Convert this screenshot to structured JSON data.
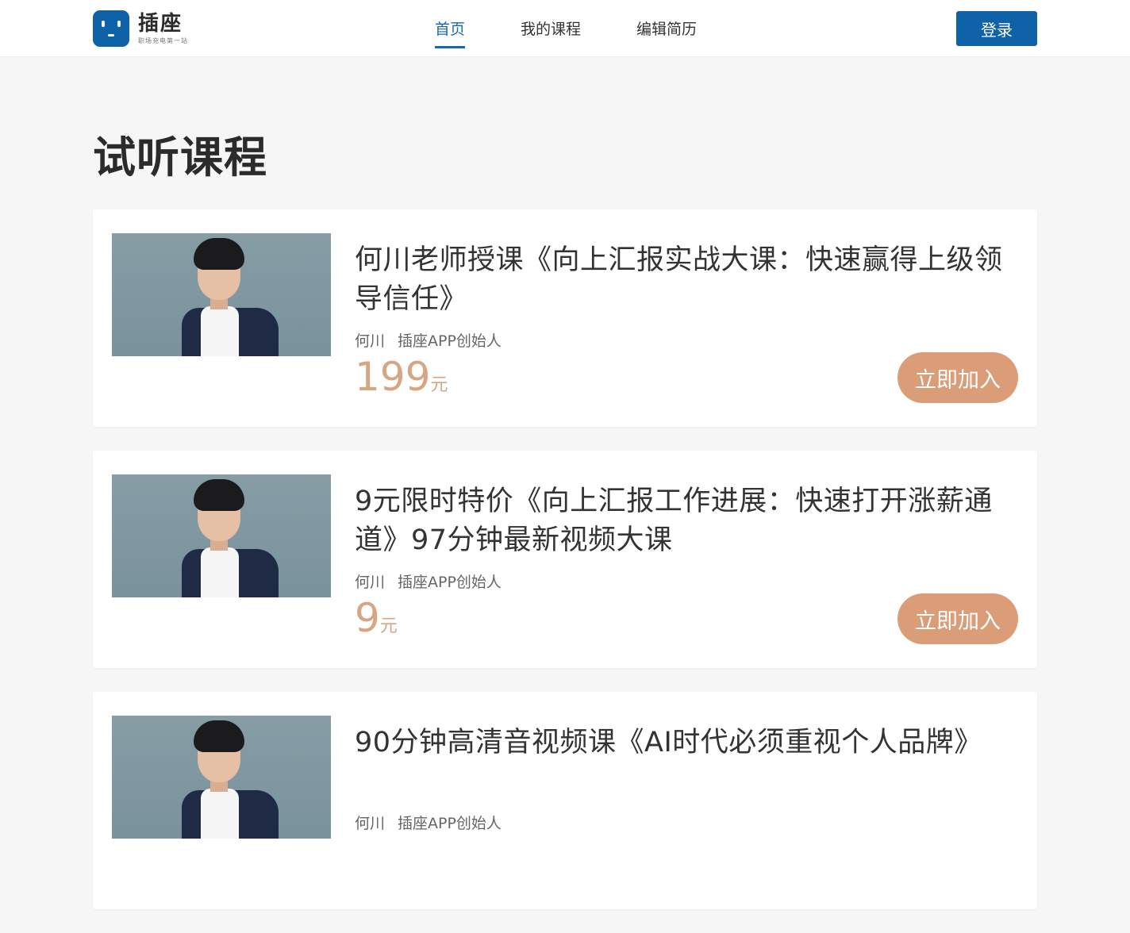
{
  "header": {
    "logo_name": "插座",
    "logo_slogan": "职场充电第一站",
    "nav": [
      {
        "label": "首页",
        "active": true
      },
      {
        "label": "我的课程",
        "active": false
      },
      {
        "label": "编辑简历",
        "active": false
      }
    ],
    "login_label": "登录"
  },
  "section_title": "试听课程",
  "courses": [
    {
      "title": "何川老师授课《向上汇报实战大课：快速赢得上级领导信任》",
      "author": "何川",
      "role": "插座APP创始人",
      "price": "199",
      "price_unit": "元",
      "join_label": "立即加入"
    },
    {
      "title": "9元限时特价《向上汇报工作进展：快速打开涨薪通道》97分钟最新视频大课",
      "author": "何川",
      "role": "插座APP创始人",
      "price": "9",
      "price_unit": "元",
      "join_label": "立即加入"
    },
    {
      "title": "90分钟高清音视频课《AI时代必须重视个人品牌》",
      "author": "何川",
      "role": "插座APP创始人",
      "price": "",
      "price_unit": "",
      "join_label": ""
    }
  ],
  "colors": {
    "brand_blue": "#0f61a8",
    "nav_active": "#1768ad",
    "price": "#d7a581",
    "join_button": "#db9d78",
    "page_bg": "#f6f6f6"
  }
}
